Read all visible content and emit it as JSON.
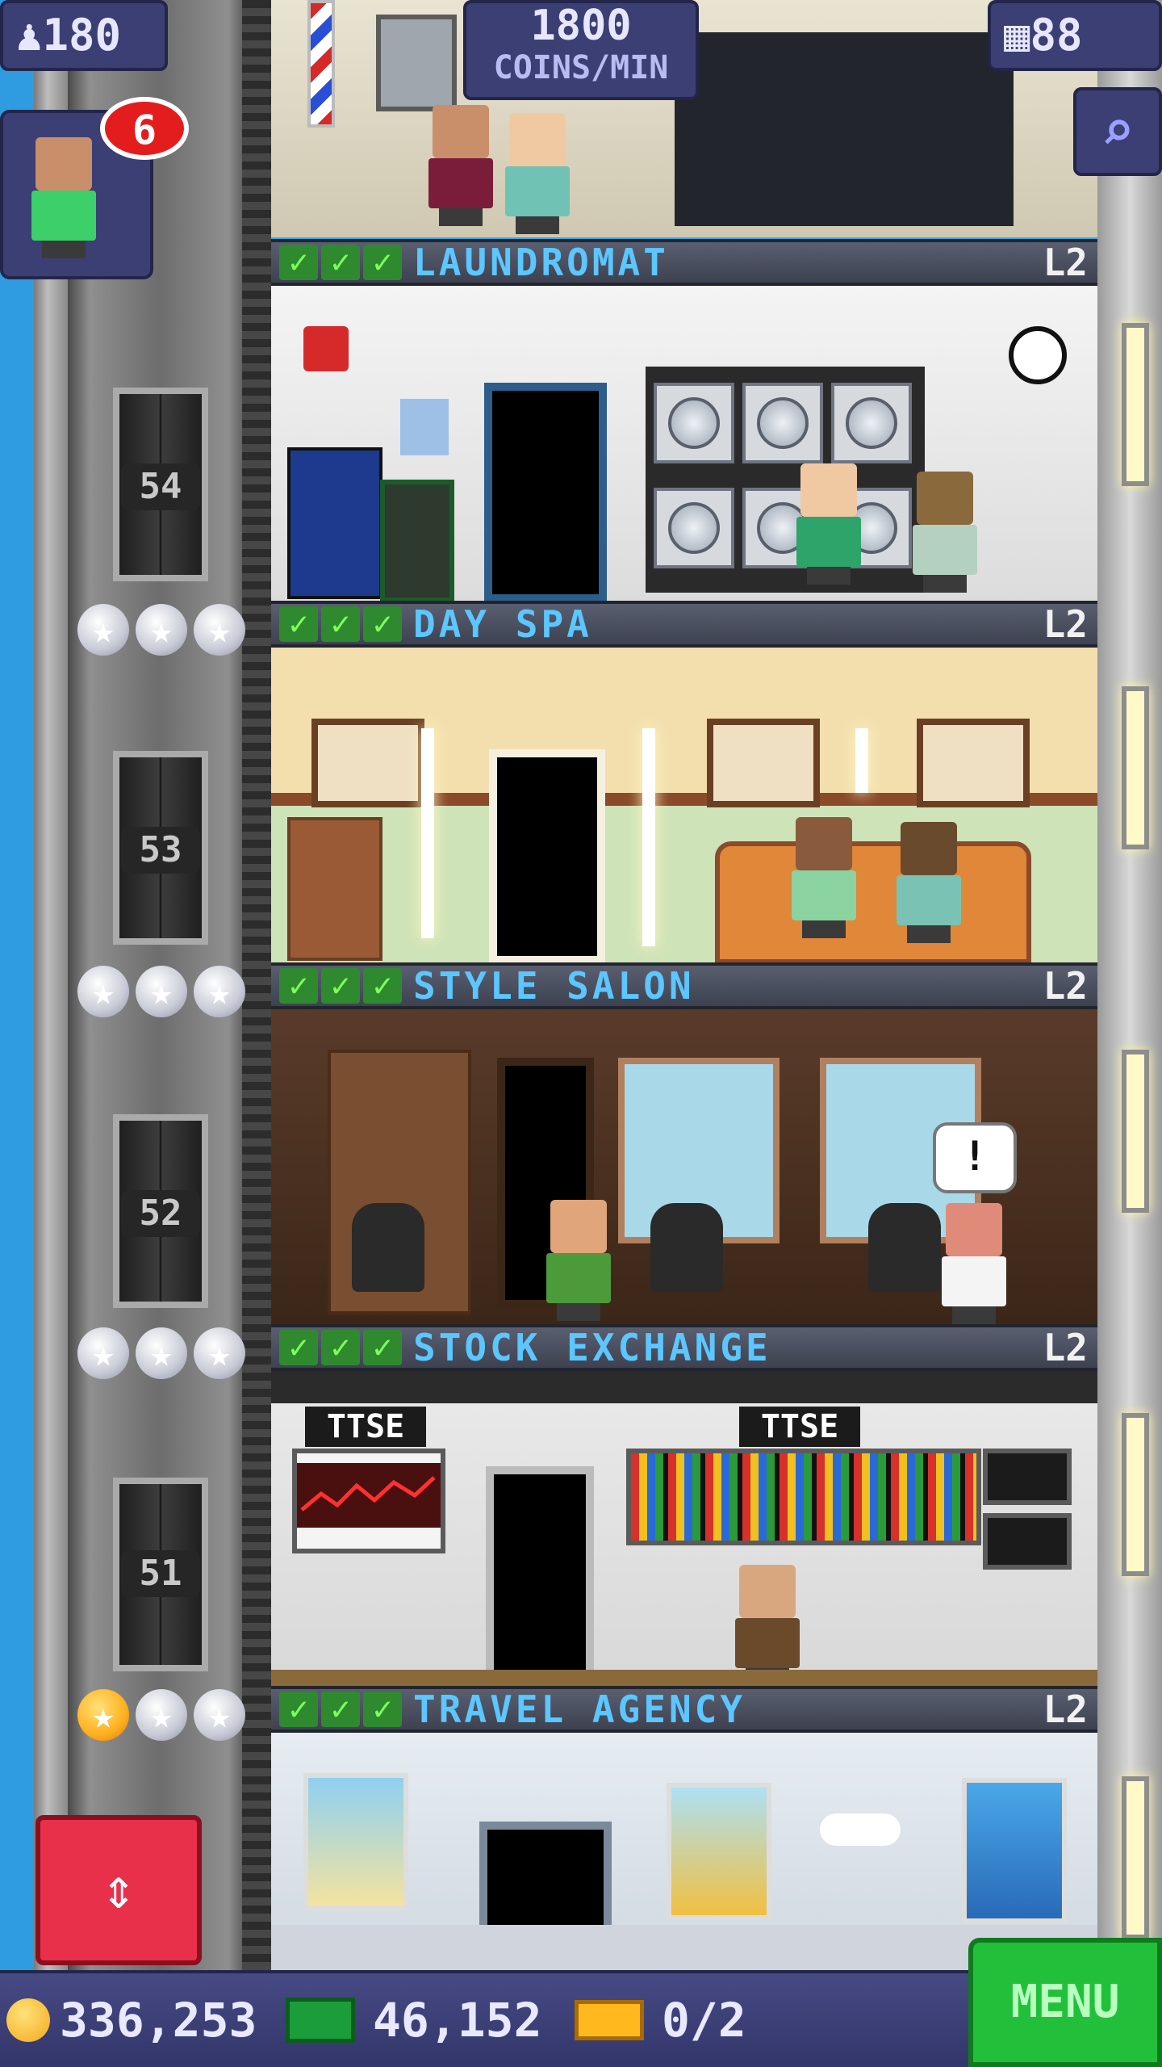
{
  "hud": {
    "population": "180",
    "coins_rate_value": "1800",
    "coins_rate_unit": "COINS/MIN",
    "rooms_count": "88",
    "notification_count": "6"
  },
  "floors": [
    {
      "number": "54",
      "name": "LAUNDROMAT",
      "level": "L2"
    },
    {
      "number": "53",
      "name": "DAY SPA",
      "level": "L2"
    },
    {
      "number": "52",
      "name": "STYLE SALON",
      "level": "L2"
    },
    {
      "number": "51",
      "name": "STOCK EXCHANGE",
      "level": "L2"
    },
    {
      "number": "",
      "name": "TRAVEL AGENCY",
      "level": "L2"
    }
  ],
  "stock_exchange": {
    "sign_left": "TTSE",
    "sign_right": "TTSE"
  },
  "salon": {
    "speech_bubble": "!"
  },
  "bottom_bar": {
    "coins": "336,253",
    "bux": "46,152",
    "tickets": "0/2",
    "menu_label": "MENU"
  },
  "icons": {
    "population": "person-icon",
    "rooms": "building-grid-icon",
    "zoom": "magnifier-icon",
    "check": "checkmark-icon",
    "star": "star-icon",
    "elevator": "up-down-arrows-icon",
    "coin": "coin-icon",
    "bux": "banknote-icon",
    "ticket": "ticket-icon"
  },
  "colors": {
    "floor_name": "#5cc6ff",
    "check_green": "#7dff5a",
    "menu_green": "#22c03a",
    "elevator_button_red": "#e8304a",
    "badge_red": "#e31d1d",
    "hud_purple": "#3c3f73"
  }
}
